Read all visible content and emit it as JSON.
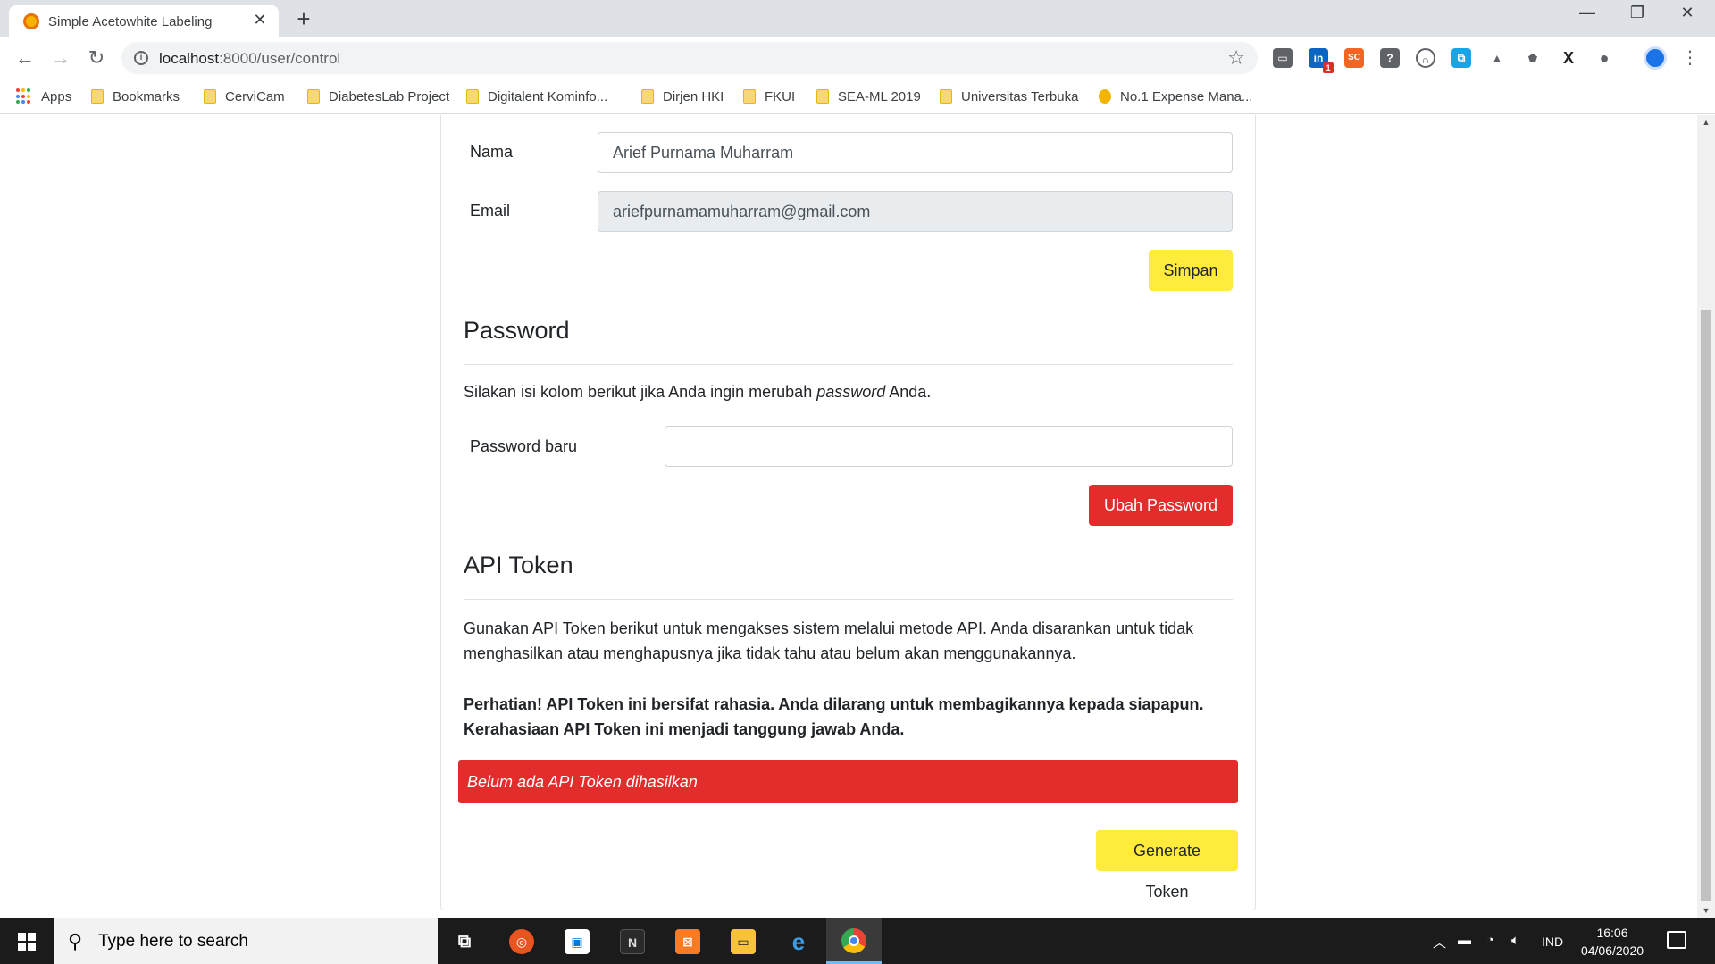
{
  "browser": {
    "tab_title": "Simple Acetowhite Labeling",
    "tab_close": "✕",
    "new_tab": "+",
    "url_host": "localhost",
    "url_path": ":8000/user/control",
    "bookmarks": [
      "Apps",
      "Bookmarks",
      "CerviCam",
      "DiabetesLab Project",
      "Digitalent Kominfo...",
      "Dirjen HKI",
      "FKUI",
      "SEA-ML 2019",
      "Universitas Terbuka",
      "No.1 Expense Mana..."
    ],
    "extension_badge": "1",
    "extensions": [
      "chat-icon",
      "linkedin-icon",
      "sc-icon",
      "help-icon",
      "headphones-icon",
      "screenshot-icon",
      "drive-icon",
      "shield-icon",
      "x-icon",
      "circle-icon"
    ]
  },
  "profile": {
    "name_label": "Nama",
    "name_value": "Arief Purnama Muharram",
    "email_label": "Email",
    "email_value": "ariefpurnamamuharram@gmail.com",
    "save_button": "Simpan"
  },
  "password": {
    "title": "Password",
    "description_before": "Silakan isi kolom berikut jika Anda ingin merubah ",
    "description_em": "password",
    "description_after": " Anda.",
    "new_password_label": "Password baru",
    "new_password_value": "",
    "change_button": "Ubah Password"
  },
  "api_token": {
    "title": "API Token",
    "description": "Gunakan API Token berikut untuk mengakses sistem melalui metode API. Anda disarankan untuk tidak menghasilkan atau menghapusnya jika tidak tahu atau belum akan menggunakannya.",
    "warning": "Perhatian! API Token ini bersifat rahasia. Anda dilarang untuk membagikannya kepada siapapun. Kerahasiaan API Token ini menjadi tanggung jawab Anda.",
    "empty_alert": "Belum ada API Token dihasilkan",
    "generate_button": "Generate Token"
  },
  "taskbar": {
    "search_placeholder": "Type here to search",
    "language": "IND",
    "time": "16:06",
    "date": "04/06/2020"
  },
  "colors": {
    "accent_yellow": "#ffeb3b",
    "danger_red": "#e32d2d"
  }
}
